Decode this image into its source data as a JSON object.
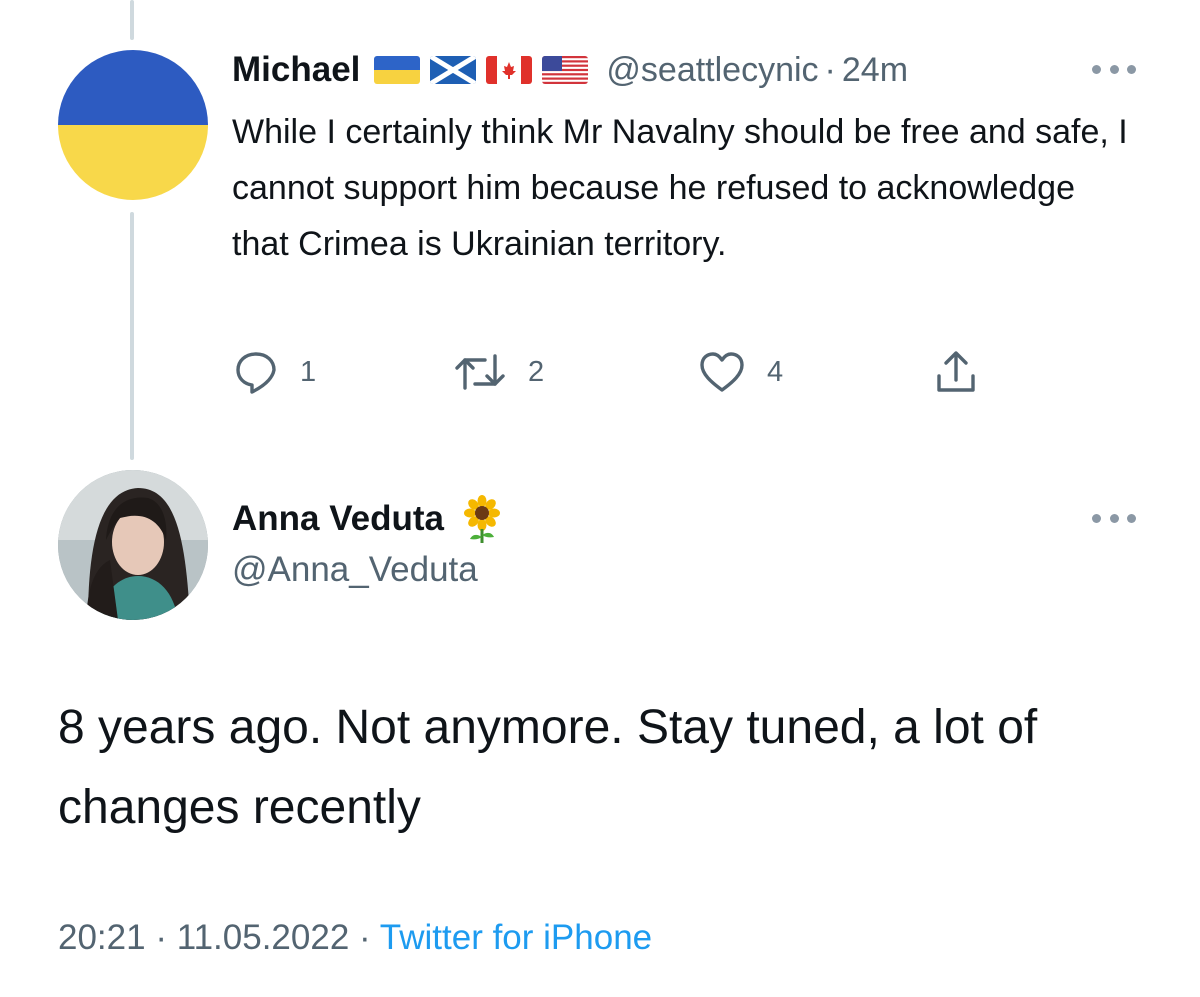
{
  "reply_tweet": {
    "avatar": {
      "colors": {
        "top": "#2d5bc1",
        "bottom": "#f8d84a"
      }
    },
    "author": {
      "display_name": "Michael",
      "flags": [
        "flag-ukraine",
        "flag-scotland",
        "flag-canada",
        "flag-usa"
      ],
      "handle": "@seattlecynic",
      "separator": "·",
      "time": "24m"
    },
    "more_icon": "more-horizontal-icon",
    "text": "While I certainly think Mr Navalny should be free and safe, I cannot support him because he refused to acknowledge that Crimea is Ukrainian territory.",
    "actions": {
      "reply": {
        "icon": "reply-icon",
        "count": "1"
      },
      "retweet": {
        "icon": "retweet-icon",
        "count": "2"
      },
      "like": {
        "icon": "heart-icon",
        "count": "4"
      },
      "share": {
        "icon": "share-icon"
      }
    }
  },
  "main_tweet": {
    "author": {
      "display_name": "Anna Veduta",
      "emoji": "sunflower-icon",
      "handle": "@Anna_Veduta"
    },
    "more_icon": "more-horizontal-icon",
    "text": "8 years ago. Not anymore. Stay tuned, a lot of changes recently",
    "footer": {
      "time": "20:21",
      "separator": "·",
      "date": "11.05.2022",
      "separator2": "·",
      "source": "Twitter for iPhone"
    }
  },
  "colors": {
    "text": "#0f1419",
    "secondary": "#536471",
    "link": "#1d9bf0",
    "thread_line": "#cfd9de"
  }
}
